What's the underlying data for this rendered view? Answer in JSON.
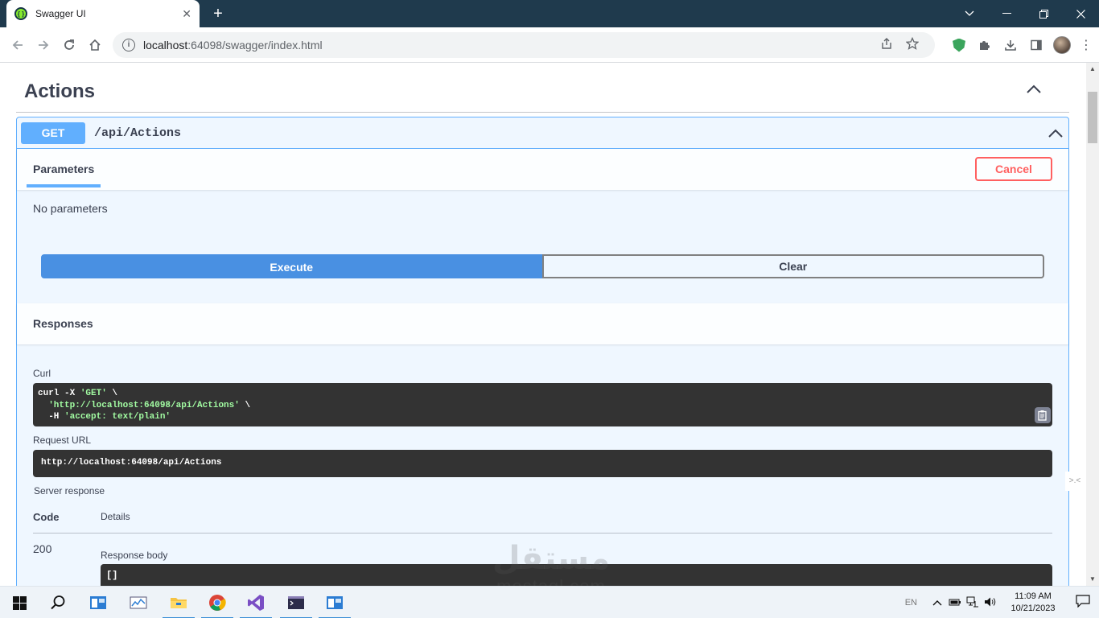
{
  "browser": {
    "tab_title": "Swagger UI",
    "tab_close": "✕",
    "new_tab": "+",
    "url_host": "localhost",
    "url_port_path": ":64098/swagger/index.html"
  },
  "section": {
    "title": "Actions"
  },
  "operation": {
    "method": "GET",
    "path": "/api/Actions",
    "method_color": "#61affe"
  },
  "parameters": {
    "tab_label": "Parameters",
    "cancel_label": "Cancel",
    "empty_text": "No parameters"
  },
  "actions": {
    "execute_label": "Execute",
    "clear_label": "Clear"
  },
  "responses": {
    "title": "Responses",
    "curl_label": "Curl",
    "curl_lines": {
      "l1_cmd": "curl -X ",
      "l1_str": "'GET'",
      "l1_tail": " \\",
      "l2_pad": "  ",
      "l2_str": "'http://localhost:64098/api/Actions'",
      "l2_tail": " \\",
      "l3_cmd": "  -H ",
      "l3_str": "'accept: text/plain'"
    },
    "request_url_label": "Request URL",
    "request_url": "http://localhost:64098/api/Actions",
    "server_response_label": "Server response",
    "col_code": "Code",
    "col_details": "Details",
    "status_code": "200",
    "response_body_label": "Response body",
    "response_body": "[]"
  },
  "watermark": {
    "arabic": "مستقل",
    "latin": "mostaql.com"
  },
  "taskbar": {
    "lang": "EN",
    "time": "11:09 AM",
    "date": "10/21/2023"
  }
}
